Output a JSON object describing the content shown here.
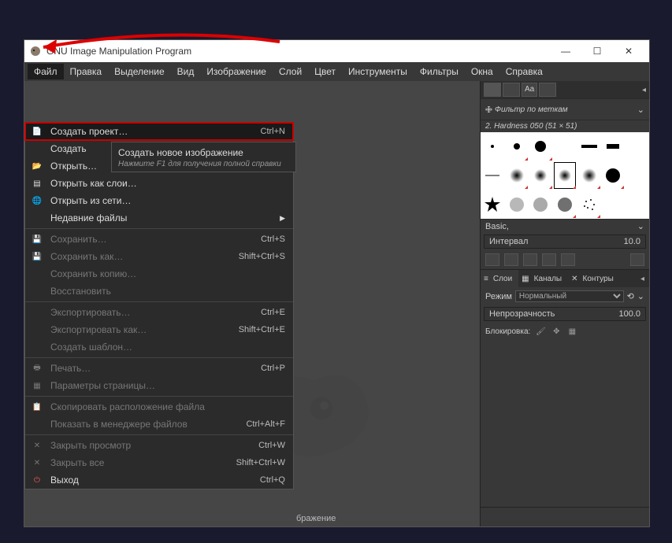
{
  "title": "GNU Image Manipulation Program",
  "menubar": [
    "Файл",
    "Правка",
    "Выделение",
    "Вид",
    "Изображение",
    "Слой",
    "Цвет",
    "Инструменты",
    "Фильтры",
    "Окна",
    "Справка"
  ],
  "menu": {
    "create_project": "Создать проект…",
    "create_project_sc": "Ctrl+N",
    "create": "Создать",
    "open": "Открыть…",
    "open_as": "Открыть как слои…",
    "open_net": "Открыть из сети…",
    "recent": "Недавние файлы",
    "save": "Сохранить…",
    "save_sc": "Ctrl+S",
    "save_as": "Сохранить как…",
    "save_as_sc": "Shift+Ctrl+S",
    "save_copy": "Сохранить копию…",
    "revert": "Восстановить",
    "export": "Экспортировать…",
    "export_sc": "Ctrl+E",
    "export_as": "Экспортировать как…",
    "export_as_sc": "Shift+Ctrl+E",
    "template": "Создать шаблон…",
    "print": "Печать…",
    "print_sc": "Ctrl+P",
    "page_setup": "Параметры страницы…",
    "copy_loc": "Скопировать расположение файла",
    "show_fm": "Показать в менеджере файлов",
    "show_fm_sc": "Ctrl+Alt+F",
    "close_view": "Закрыть просмотр",
    "close_view_sc": "Ctrl+W",
    "close_all": "Закрыть все",
    "close_all_sc": "Shift+Ctrl+W",
    "quit": "Выход",
    "quit_sc": "Ctrl+Q"
  },
  "submenu": {
    "title": "Создать новое изображение",
    "hint": "Нажмите F1 для получения полной справки"
  },
  "canvas_footer": "бражение",
  "right": {
    "filter_label": "Фильтр по меткам",
    "brush_name": "2. Hardness 050 (51 × 51)",
    "preset_label": "Basic,",
    "interval_label": "Интервал",
    "interval_value": "10.0",
    "tab_layers": "Слои",
    "tab_channels": "Каналы",
    "tab_paths": "Контуры",
    "mode_label": "Режим",
    "mode_value": "Нормальный",
    "opacity_label": "Непрозрачность",
    "opacity_value": "100.0",
    "lock_label": "Блокировка:"
  }
}
